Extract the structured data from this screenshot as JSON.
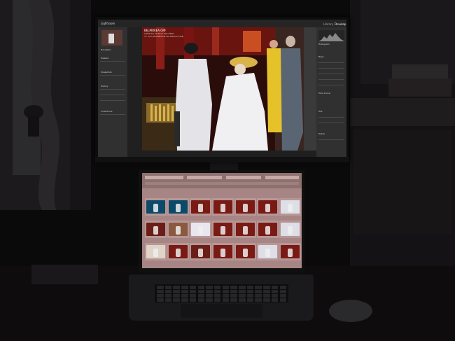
{
  "monitor": {
    "app_name": "Lightroom",
    "file_name": "BELMOKEA.ORF",
    "file_meta_line1": "1/250 sec at f/2.8, ISO 2500",
    "file_meta_line2": "77 mm (OLYMPUS M.40-150mm F2.8)",
    "module_tabs": [
      "Library",
      "Develop"
    ],
    "left_panel_sections": [
      "Navigator",
      "Presets",
      "Snapshots",
      "History",
      "Collections"
    ],
    "right_panel_sections": [
      "Histogram",
      "Basic",
      "Tone Curve",
      "HSL",
      "Detail"
    ]
  },
  "laptop": {
    "grid_rows": 3,
    "grid_columns": 7
  },
  "colors": {
    "monitor_bezel": "#0c0c0c",
    "lightroom_panel": "#303030",
    "laptop_grid_bg": "#a78584",
    "stage_red": "#7a1412",
    "costume_white": "#e6e6ea",
    "costume_yellow": "#e6c22a"
  }
}
